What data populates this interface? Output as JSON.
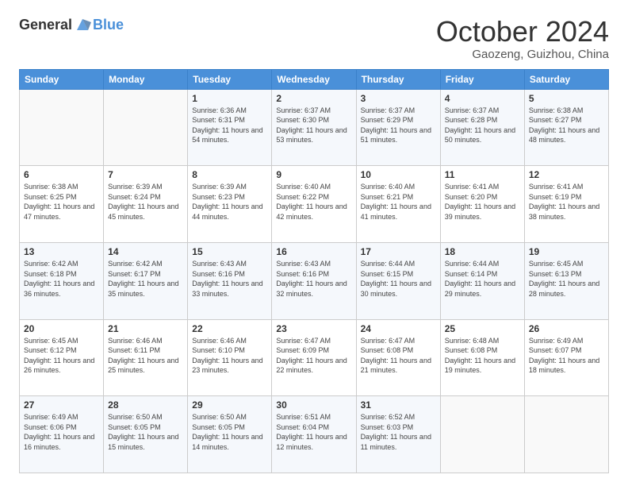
{
  "header": {
    "logo": {
      "general": "General",
      "blue": "Blue"
    },
    "title": "October 2024",
    "location": "Gaozeng, Guizhou, China"
  },
  "weekdays": [
    "Sunday",
    "Monday",
    "Tuesday",
    "Wednesday",
    "Thursday",
    "Friday",
    "Saturday"
  ],
  "weeks": [
    [
      {
        "day": "",
        "sunrise": "",
        "sunset": "",
        "daylight": ""
      },
      {
        "day": "",
        "sunrise": "",
        "sunset": "",
        "daylight": ""
      },
      {
        "day": "1",
        "sunrise": "Sunrise: 6:36 AM",
        "sunset": "Sunset: 6:31 PM",
        "daylight": "Daylight: 11 hours and 54 minutes."
      },
      {
        "day": "2",
        "sunrise": "Sunrise: 6:37 AM",
        "sunset": "Sunset: 6:30 PM",
        "daylight": "Daylight: 11 hours and 53 minutes."
      },
      {
        "day": "3",
        "sunrise": "Sunrise: 6:37 AM",
        "sunset": "Sunset: 6:29 PM",
        "daylight": "Daylight: 11 hours and 51 minutes."
      },
      {
        "day": "4",
        "sunrise": "Sunrise: 6:37 AM",
        "sunset": "Sunset: 6:28 PM",
        "daylight": "Daylight: 11 hours and 50 minutes."
      },
      {
        "day": "5",
        "sunrise": "Sunrise: 6:38 AM",
        "sunset": "Sunset: 6:27 PM",
        "daylight": "Daylight: 11 hours and 48 minutes."
      }
    ],
    [
      {
        "day": "6",
        "sunrise": "Sunrise: 6:38 AM",
        "sunset": "Sunset: 6:25 PM",
        "daylight": "Daylight: 11 hours and 47 minutes."
      },
      {
        "day": "7",
        "sunrise": "Sunrise: 6:39 AM",
        "sunset": "Sunset: 6:24 PM",
        "daylight": "Daylight: 11 hours and 45 minutes."
      },
      {
        "day": "8",
        "sunrise": "Sunrise: 6:39 AM",
        "sunset": "Sunset: 6:23 PM",
        "daylight": "Daylight: 11 hours and 44 minutes."
      },
      {
        "day": "9",
        "sunrise": "Sunrise: 6:40 AM",
        "sunset": "Sunset: 6:22 PM",
        "daylight": "Daylight: 11 hours and 42 minutes."
      },
      {
        "day": "10",
        "sunrise": "Sunrise: 6:40 AM",
        "sunset": "Sunset: 6:21 PM",
        "daylight": "Daylight: 11 hours and 41 minutes."
      },
      {
        "day": "11",
        "sunrise": "Sunrise: 6:41 AM",
        "sunset": "Sunset: 6:20 PM",
        "daylight": "Daylight: 11 hours and 39 minutes."
      },
      {
        "day": "12",
        "sunrise": "Sunrise: 6:41 AM",
        "sunset": "Sunset: 6:19 PM",
        "daylight": "Daylight: 11 hours and 38 minutes."
      }
    ],
    [
      {
        "day": "13",
        "sunrise": "Sunrise: 6:42 AM",
        "sunset": "Sunset: 6:18 PM",
        "daylight": "Daylight: 11 hours and 36 minutes."
      },
      {
        "day": "14",
        "sunrise": "Sunrise: 6:42 AM",
        "sunset": "Sunset: 6:17 PM",
        "daylight": "Daylight: 11 hours and 35 minutes."
      },
      {
        "day": "15",
        "sunrise": "Sunrise: 6:43 AM",
        "sunset": "Sunset: 6:16 PM",
        "daylight": "Daylight: 11 hours and 33 minutes."
      },
      {
        "day": "16",
        "sunrise": "Sunrise: 6:43 AM",
        "sunset": "Sunset: 6:16 PM",
        "daylight": "Daylight: 11 hours and 32 minutes."
      },
      {
        "day": "17",
        "sunrise": "Sunrise: 6:44 AM",
        "sunset": "Sunset: 6:15 PM",
        "daylight": "Daylight: 11 hours and 30 minutes."
      },
      {
        "day": "18",
        "sunrise": "Sunrise: 6:44 AM",
        "sunset": "Sunset: 6:14 PM",
        "daylight": "Daylight: 11 hours and 29 minutes."
      },
      {
        "day": "19",
        "sunrise": "Sunrise: 6:45 AM",
        "sunset": "Sunset: 6:13 PM",
        "daylight": "Daylight: 11 hours and 28 minutes."
      }
    ],
    [
      {
        "day": "20",
        "sunrise": "Sunrise: 6:45 AM",
        "sunset": "Sunset: 6:12 PM",
        "daylight": "Daylight: 11 hours and 26 minutes."
      },
      {
        "day": "21",
        "sunrise": "Sunrise: 6:46 AM",
        "sunset": "Sunset: 6:11 PM",
        "daylight": "Daylight: 11 hours and 25 minutes."
      },
      {
        "day": "22",
        "sunrise": "Sunrise: 6:46 AM",
        "sunset": "Sunset: 6:10 PM",
        "daylight": "Daylight: 11 hours and 23 minutes."
      },
      {
        "day": "23",
        "sunrise": "Sunrise: 6:47 AM",
        "sunset": "Sunset: 6:09 PM",
        "daylight": "Daylight: 11 hours and 22 minutes."
      },
      {
        "day": "24",
        "sunrise": "Sunrise: 6:47 AM",
        "sunset": "Sunset: 6:08 PM",
        "daylight": "Daylight: 11 hours and 21 minutes."
      },
      {
        "day": "25",
        "sunrise": "Sunrise: 6:48 AM",
        "sunset": "Sunset: 6:08 PM",
        "daylight": "Daylight: 11 hours and 19 minutes."
      },
      {
        "day": "26",
        "sunrise": "Sunrise: 6:49 AM",
        "sunset": "Sunset: 6:07 PM",
        "daylight": "Daylight: 11 hours and 18 minutes."
      }
    ],
    [
      {
        "day": "27",
        "sunrise": "Sunrise: 6:49 AM",
        "sunset": "Sunset: 6:06 PM",
        "daylight": "Daylight: 11 hours and 16 minutes."
      },
      {
        "day": "28",
        "sunrise": "Sunrise: 6:50 AM",
        "sunset": "Sunset: 6:05 PM",
        "daylight": "Daylight: 11 hours and 15 minutes."
      },
      {
        "day": "29",
        "sunrise": "Sunrise: 6:50 AM",
        "sunset": "Sunset: 6:05 PM",
        "daylight": "Daylight: 11 hours and 14 minutes."
      },
      {
        "day": "30",
        "sunrise": "Sunrise: 6:51 AM",
        "sunset": "Sunset: 6:04 PM",
        "daylight": "Daylight: 11 hours and 12 minutes."
      },
      {
        "day": "31",
        "sunrise": "Sunrise: 6:52 AM",
        "sunset": "Sunset: 6:03 PM",
        "daylight": "Daylight: 11 hours and 11 minutes."
      },
      {
        "day": "",
        "sunrise": "",
        "sunset": "",
        "daylight": ""
      },
      {
        "day": "",
        "sunrise": "",
        "sunset": "",
        "daylight": ""
      }
    ]
  ]
}
